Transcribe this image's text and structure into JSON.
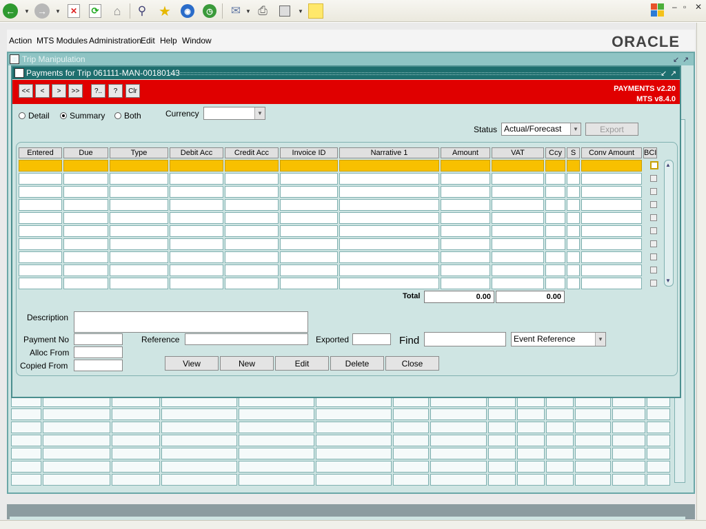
{
  "browser": {
    "toolbar_icons": [
      "back-icon",
      "forward-icon",
      "stop-icon",
      "refresh-icon",
      "home-icon",
      "search-icon",
      "favorites-icon",
      "media-icon",
      "history-icon",
      "mail-icon",
      "print-icon",
      "edit-icon",
      "note-icon"
    ],
    "window_controls": [
      "–",
      "▫",
      "✕"
    ]
  },
  "menubar": {
    "items": [
      {
        "label": "Action"
      },
      {
        "label": "MTS Modules"
      },
      {
        "label": "Administration"
      },
      {
        "label": "Edit"
      },
      {
        "label": "Help"
      },
      {
        "label": "Window"
      }
    ],
    "logo": "ORACLE"
  },
  "trip_window": {
    "title": "Trip Manipulation"
  },
  "payments_window": {
    "title": "Payments for Trip 061111-MAN-00180143",
    "nav_buttons": [
      "<<",
      "<",
      ">",
      ">>",
      "?..",
      "?",
      "Clr"
    ],
    "version1": "PAYMENTS v2.20",
    "version2": "MTS v8.4.0",
    "view_options": [
      {
        "label": "Detail",
        "selected": false
      },
      {
        "label": "Summary",
        "selected": true
      },
      {
        "label": "Both",
        "selected": false
      }
    ],
    "currency_label": "Currency",
    "currency_value": "",
    "status_label": "Status",
    "status_value": "Actual/Forecast",
    "export_label": "Export",
    "columns": [
      "Entered",
      "Due",
      "Type",
      "Debit Acc",
      "Credit Acc",
      "Invoice ID",
      "Narrative 1",
      "Amount",
      "VAT",
      "Ccy",
      "S",
      "Conv Amount",
      "BCI"
    ],
    "row_count": 10,
    "total_label": "Total",
    "total_amount": "0.00",
    "total_vat": "0.00",
    "description_label": "Description",
    "payment_no_label": "Payment No",
    "reference_label": "Reference",
    "exported_label": "Exported",
    "find_label": "Find",
    "find_by_value": "Event Reference",
    "alloc_from_label": "Alloc From",
    "copied_from_label": "Copied From",
    "buttons": [
      "View",
      "New",
      "Edit",
      "Delete",
      "Close"
    ]
  },
  "colors": {
    "banner": "#e00000",
    "selected_row": "#f8c000",
    "window_bg": "#cfe5e3",
    "title_bar": "#1e6e6e"
  }
}
